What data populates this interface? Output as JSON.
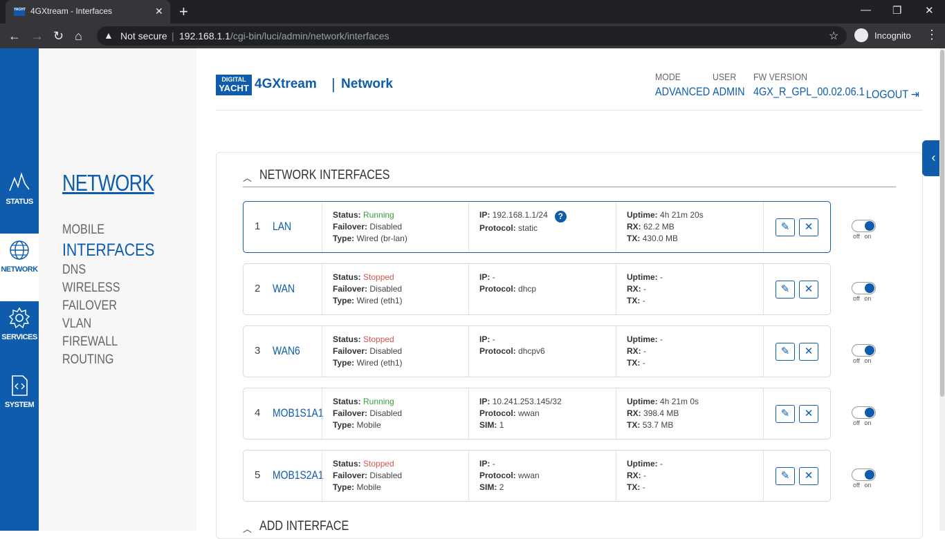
{
  "browser": {
    "tab_title": "4GXtream - Interfaces",
    "favicon_text": "YACHT",
    "security": "Not secure",
    "url_host": "192.168.1.1",
    "url_path": "/cgi-bin/luci/admin/network/interfaces",
    "profile": "Incognito"
  },
  "iconbar": [
    {
      "label": "STATUS",
      "icon": "status-pulse-icon"
    },
    {
      "label": "NETWORK",
      "icon": "globe-icon"
    },
    {
      "label": "SERVICES",
      "icon": "gear-icon"
    },
    {
      "label": "SYSTEM",
      "icon": "system-file-icon"
    }
  ],
  "submenu": {
    "title": "NETWORK",
    "items": [
      "MOBILE",
      "INTERFACES",
      "DNS",
      "WIRELESS",
      "FAILOVER",
      "VLAN",
      "FIREWALL",
      "ROUTING"
    ],
    "active": "INTERFACES"
  },
  "header": {
    "logo_top": "DIGITAL",
    "logo_bottom": "YACHT",
    "brand": "4GXtream",
    "section": "Network",
    "mode_label": "MODE",
    "mode_value": "ADVANCED",
    "user_label": "USER",
    "user_value": "ADMIN",
    "fw_label": "FW VERSION",
    "fw_value": "4GX_R_GPL_00.02.06.1",
    "logout": "LOGOUT"
  },
  "sections": {
    "interfaces_title": "NETWORK INTERFACES",
    "add_title": "ADD INTERFACE"
  },
  "labels": {
    "status": "Status:",
    "failover": "Failover:",
    "type": "Type:",
    "ip": "IP:",
    "protocol": "Protocol:",
    "sim": "SIM:",
    "uptime": "Uptime:",
    "rx": "RX:",
    "tx": "TX:",
    "off": "off",
    "on": "on"
  },
  "interfaces": [
    {
      "num": "1",
      "name": "LAN",
      "status": "Running",
      "failover": "Disabled",
      "type": "Wired (br-lan)",
      "ip": "192.168.1.1/24",
      "protocol": "static",
      "sim": "",
      "uptime": "4h 21m 20s",
      "rx": "62.2 MB",
      "tx": "430.0 MB"
    },
    {
      "num": "2",
      "name": "WAN",
      "status": "Stopped",
      "failover": "Disabled",
      "type": "Wired (eth1)",
      "ip": "-",
      "protocol": "dhcp",
      "sim": "",
      "uptime": "-",
      "rx": "-",
      "tx": "-"
    },
    {
      "num": "3",
      "name": "WAN6",
      "status": "Stopped",
      "failover": "Disabled",
      "type": "Wired (eth1)",
      "ip": "-",
      "protocol": "dhcpv6",
      "sim": "",
      "uptime": "-",
      "rx": "-",
      "tx": "-"
    },
    {
      "num": "4",
      "name": "MOB1S1A1",
      "status": "Running",
      "failover": "Disabled",
      "type": "Mobile",
      "ip": "10.241.253.145/32",
      "protocol": "wwan",
      "sim": "1",
      "uptime": "4h 21m 0s",
      "rx": "398.4 MB",
      "tx": "53.7 MB"
    },
    {
      "num": "5",
      "name": "MOB1S2A1",
      "status": "Stopped",
      "failover": "Disabled",
      "type": "Mobile",
      "ip": "-",
      "protocol": "wwan",
      "sim": "2",
      "uptime": "-",
      "rx": "-",
      "tx": "-"
    }
  ],
  "colors": {
    "brand_blue": "#0f5cad",
    "running": "#3a9d3a",
    "stopped": "#d9534f"
  }
}
